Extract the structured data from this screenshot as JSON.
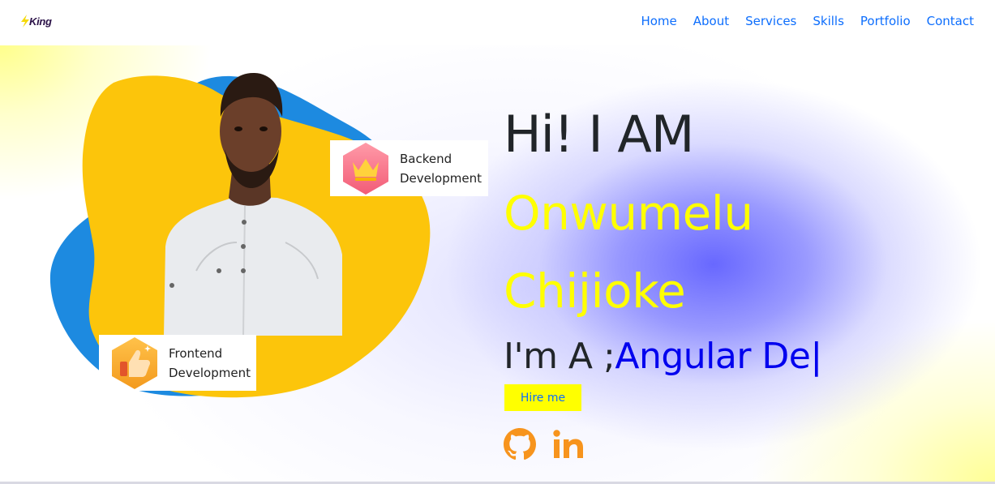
{
  "brand": {
    "logo_text": "King",
    "logo_icon": "lightning-bolt-icon"
  },
  "nav": {
    "items": [
      {
        "label": "Home"
      },
      {
        "label": "About"
      },
      {
        "label": "Services"
      },
      {
        "label": "Skills"
      },
      {
        "label": "Portfolio"
      },
      {
        "label": "Contact"
      }
    ]
  },
  "hero": {
    "greeting": "Hi! I AM",
    "name_first": "Onwumelu",
    "name_last": "Chijioke",
    "role_prefix": "I'm A ;",
    "role_typed": "Angular De",
    "cursor": "|",
    "hire_label": "Hire me"
  },
  "badges": {
    "backend": {
      "line1": "Backend",
      "line2": "Development",
      "icon": "crown-icon"
    },
    "frontend": {
      "line1": "Frontend",
      "line2": "Development",
      "icon": "thumbs-up-icon"
    }
  },
  "socials": [
    {
      "icon": "github-icon"
    },
    {
      "icon": "linkedin-icon"
    }
  ],
  "colors": {
    "nav_link": "#0d6efd",
    "name": "#ffff00",
    "role_typed": "#0000ee",
    "blob_yellow": "#fcc50b",
    "blob_blue": "#1d8ae0",
    "social": "#f7941d",
    "hire_bg": "#ffff00"
  }
}
